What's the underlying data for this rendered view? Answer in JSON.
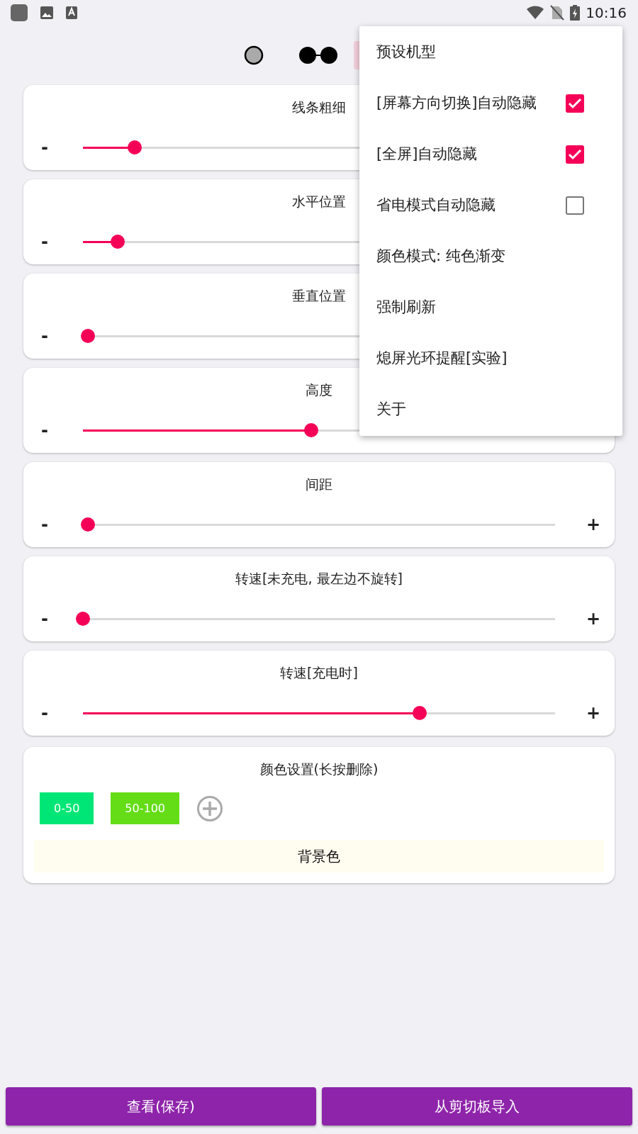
{
  "status_bar": {
    "time": "10:16"
  },
  "sliders": [
    {
      "title": "线条粗细",
      "minus": "-",
      "level": 0.11
    },
    {
      "title": "水平位置",
      "minus": "-",
      "level": 0.074
    },
    {
      "title": "垂直位置",
      "minus": "-",
      "level": 0.01
    },
    {
      "title": "高度",
      "minus": "-",
      "level": 0.483
    },
    {
      "title": "间距",
      "minus": "-",
      "plus": "+",
      "level": 0.01
    },
    {
      "title": "转速[未充电, 最左边不旋转]",
      "minus": "-",
      "plus": "+",
      "level": 0
    },
    {
      "title": "转速[充电时]",
      "minus": "-",
      "plus": "+",
      "level": 0.713
    }
  ],
  "color_settings": {
    "title": "颜色设置(长按删除)",
    "chips": [
      {
        "label": "0-50",
        "color": "#00e676"
      },
      {
        "label": "50-100",
        "color": "#64dd17"
      }
    ],
    "background_label": "背景色"
  },
  "bottom_buttons": [
    "查看(保存)",
    "从剪切板导入"
  ],
  "menu": [
    {
      "kind": "plain",
      "label": "预设机型"
    },
    {
      "kind": "check",
      "label": "[屏幕方向切换]自动隐藏",
      "checked": true
    },
    {
      "kind": "check",
      "label": "[全屏]自动隐藏",
      "checked": true
    },
    {
      "kind": "check",
      "label": "省电模式自动隐藏",
      "checked": false
    },
    {
      "kind": "plain",
      "label": "颜色模式: 纯色渐变"
    },
    {
      "kind": "plain",
      "label": "强制刷新"
    },
    {
      "kind": "plain",
      "label": "熄屏光环提醒[实验]"
    },
    {
      "kind": "plain",
      "label": "关于"
    }
  ]
}
